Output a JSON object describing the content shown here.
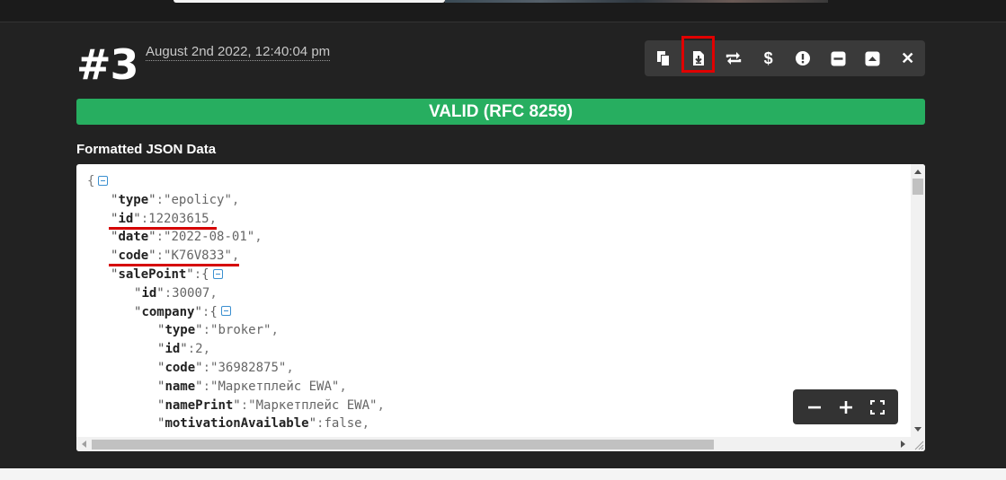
{
  "entry": {
    "number": "#3",
    "date": "August 2nd 2022, 12:40:04 pm"
  },
  "toolbar": {
    "buttons": [
      {
        "name": "copy",
        "icon": "copy-icon"
      },
      {
        "name": "download",
        "icon": "file-download-icon",
        "highlighted": true
      },
      {
        "name": "convert",
        "icon": "swap-icon"
      },
      {
        "name": "dollar",
        "icon": "dollar-icon",
        "label": "$"
      },
      {
        "name": "alert",
        "icon": "exclamation-circle-icon"
      },
      {
        "name": "minimize",
        "icon": "minus-square-icon"
      },
      {
        "name": "collapse",
        "icon": "caret-up-square-icon"
      },
      {
        "name": "close",
        "icon": "close-icon",
        "label": "✕"
      }
    ]
  },
  "status": {
    "text": "VALID (RFC 8259)",
    "color": "#27ae60"
  },
  "json_viewer": {
    "label": "Formatted JSON Data",
    "lines": [
      {
        "indent": 0,
        "text": "{",
        "toggle": true
      },
      {
        "indent": 1,
        "key": "type",
        "value": "\"epolicy\"",
        "suffix": ","
      },
      {
        "indent": 1,
        "key": "id",
        "value": "12203615",
        "suffix": ",",
        "underlined": true
      },
      {
        "indent": 1,
        "key": "date",
        "value": "\"2022-08-01\"",
        "suffix": ","
      },
      {
        "indent": 1,
        "key": "code",
        "value": "\"K76V833\"",
        "suffix": ",",
        "underlined": true
      },
      {
        "indent": 1,
        "key": "salePoint",
        "value": "{",
        "suffix": "",
        "toggle": true
      },
      {
        "indent": 2,
        "key": "id",
        "value": "30007",
        "suffix": ","
      },
      {
        "indent": 2,
        "key": "company",
        "value": "{",
        "suffix": "",
        "toggle": true
      },
      {
        "indent": 3,
        "key": "type",
        "value": "\"broker\"",
        "suffix": ","
      },
      {
        "indent": 3,
        "key": "id",
        "value": "2",
        "suffix": ","
      },
      {
        "indent": 3,
        "key": "code",
        "value": "\"36982875\"",
        "suffix": ","
      },
      {
        "indent": 3,
        "key": "name",
        "value": "\"Маркетплейс EWA\"",
        "suffix": ","
      },
      {
        "indent": 3,
        "key": "namePrint",
        "value": "\"Маркетплейс EWA\"",
        "suffix": ","
      },
      {
        "indent": 3,
        "key": "motivationAvailable",
        "value": "false",
        "suffix": ","
      }
    ]
  },
  "zoom": {
    "buttons": [
      "zoom-out",
      "zoom-in",
      "fullscreen"
    ]
  }
}
